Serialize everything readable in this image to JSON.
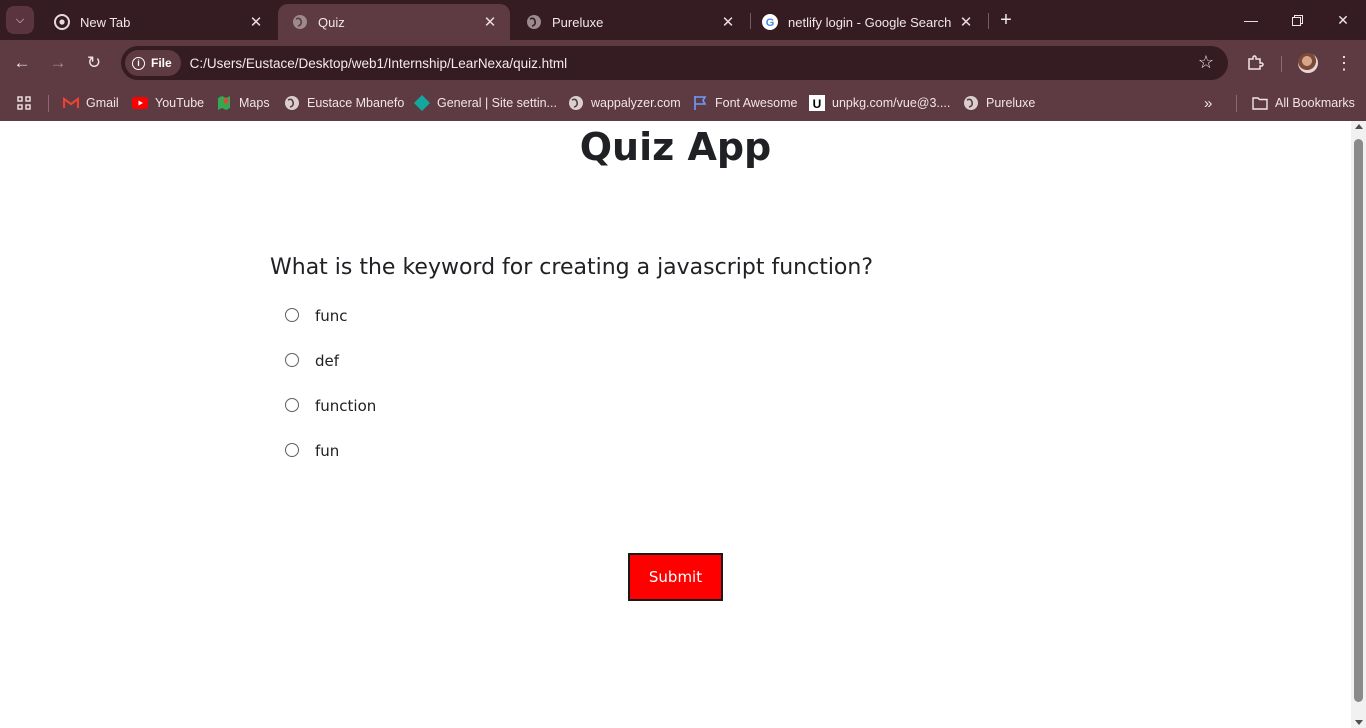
{
  "browser": {
    "tabs": [
      {
        "title": "New Tab",
        "icon": "chrome-icon"
      },
      {
        "title": "Quiz",
        "icon": "globe-icon",
        "active": true
      },
      {
        "title": "Pureluxe",
        "icon": "globe-icon"
      },
      {
        "title": "netlify login - Google Search",
        "icon": "google-icon"
      }
    ],
    "address": {
      "chip_label": "File",
      "url": "C:/Users/Eustace/Desktop/web1/Internship/LearNexa/quiz.html"
    },
    "bookmarks": [
      {
        "label": "Gmail",
        "icon": "gmail-icon"
      },
      {
        "label": "YouTube",
        "icon": "youtube-icon"
      },
      {
        "label": "Maps",
        "icon": "maps-icon"
      },
      {
        "label": "Eustace Mbanefo",
        "icon": "globe-icon"
      },
      {
        "label": "General | Site settin...",
        "icon": "netlify-icon"
      },
      {
        "label": "wappalyzer.com",
        "icon": "globe-icon"
      },
      {
        "label": "Font Awesome",
        "icon": "flag-icon"
      },
      {
        "label": "unpkg.com/vue@3....",
        "icon": "unpkg-icon"
      },
      {
        "label": "Pureluxe",
        "icon": "globe-icon"
      }
    ],
    "all_bookmarks_label": "All Bookmarks",
    "colors": {
      "frame": "#351c23",
      "toolbar": "#5e3a43"
    }
  },
  "quiz": {
    "title": "Quiz App",
    "question": "What is the keyword for creating a javascript function?",
    "options": [
      "func",
      "def",
      "function",
      "fun"
    ],
    "submit_label": "Submit",
    "colors": {
      "submit_bg": "#ff0000"
    }
  }
}
